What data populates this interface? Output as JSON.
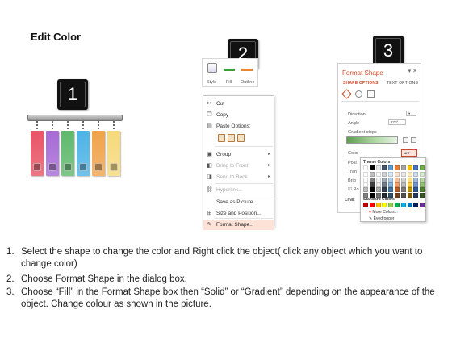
{
  "title": "Edit Color",
  "steps": [
    "1",
    "2",
    "3"
  ],
  "panel1": {
    "tag_colors": [
      "#e85466",
      "#a66ad6",
      "#5fb86c",
      "#4cb3e6",
      "#f0a24a",
      "#f6d97a"
    ]
  },
  "ribbon": {
    "labels": [
      "Style",
      "Fill",
      "Outline"
    ],
    "fill_color": "#3a9c3a",
    "outline_color": "#e8872c"
  },
  "context_menu": {
    "items": [
      {
        "icon": "scissors-icon",
        "glyph": "✂",
        "label": "Cut",
        "disabled": false,
        "arrow": false
      },
      {
        "icon": "copy-icon",
        "glyph": "❐",
        "label": "Copy",
        "disabled": false,
        "arrow": false
      },
      {
        "icon": "paste-icon",
        "glyph": "▤",
        "label": "Paste Options:",
        "disabled": false,
        "arrow": false
      },
      {
        "icon": "group-icon",
        "glyph": "▣",
        "label": "Group",
        "disabled": false,
        "arrow": true
      },
      {
        "icon": "bring-front-icon",
        "glyph": "◧",
        "label": "Bring to Front",
        "disabled": true,
        "arrow": true
      },
      {
        "icon": "send-back-icon",
        "glyph": "◨",
        "label": "Send to Back",
        "disabled": true,
        "arrow": true
      },
      {
        "icon": "hyperlink-icon",
        "glyph": "⛓",
        "label": "Hyperlink...",
        "disabled": true,
        "arrow": false
      },
      {
        "icon": "save-picture-icon",
        "glyph": "",
        "label": "Save as Picture...",
        "disabled": false,
        "arrow": false
      },
      {
        "icon": "size-position-icon",
        "glyph": "⊞",
        "label": "Size and Position...",
        "disabled": false,
        "arrow": false
      },
      {
        "icon": "format-shape-icon",
        "glyph": "✎",
        "label": "Format Shape...",
        "disabled": false,
        "arrow": false,
        "highlighted": true
      }
    ]
  },
  "format_pane": {
    "title": "Format Shape",
    "tabs": [
      "SHAPE OPTIONS",
      "TEXT OPTIONS"
    ],
    "direction_label": "Direction",
    "angle_label": "Angle",
    "angle_value": "270°",
    "gradient_stops_label": "Gradient stops",
    "color_label": "Color",
    "position_label": "Posi",
    "transparency_label": "Tran",
    "brightness_label": "Brig",
    "rotate_label": "Ro",
    "line_label": "LINE",
    "accent_color": "#d24726"
  },
  "color_picker": {
    "theme_colors_label": "Theme Colors",
    "standard_colors_label": "Standard Colors",
    "more_colors_label": "More Colors...",
    "eyedropper_label": "Eyedropper",
    "theme_top": [
      "#ffffff",
      "#000000",
      "#e7e6e6",
      "#44546a",
      "#5b9bd5",
      "#ed7d31",
      "#a5a5a5",
      "#ffc000",
      "#4472c4",
      "#70ad47"
    ],
    "standard": [
      "#c00000",
      "#ff0000",
      "#ffc000",
      "#ffff00",
      "#92d050",
      "#00b050",
      "#00b0f0",
      "#0070c0",
      "#002060",
      "#7030a0"
    ]
  },
  "instructions": [
    {
      "num": "1.",
      "text": "Select the shape to change the color and Right click the object( click any object which you want to change color)"
    },
    {
      "num": "2.",
      "text": "Choose Format Shape in the dialog box."
    },
    {
      "num": "3.",
      "text": "Choose “Fill” in the Format Shape box then “Solid” or “Gradient” depending on the appearance of the object. Change colour as shown in the picture."
    }
  ]
}
